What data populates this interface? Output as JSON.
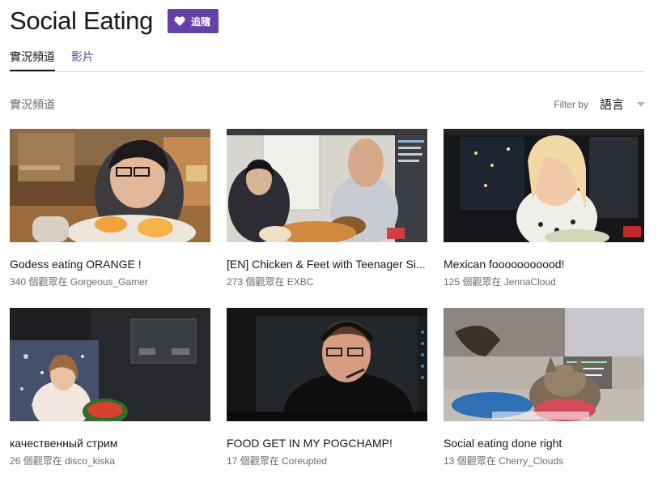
{
  "header": {
    "title": "Social Eating",
    "follow_label": "追隨"
  },
  "tabs": [
    {
      "label": "實況頻道",
      "active": true
    },
    {
      "label": "影片",
      "active": false
    }
  ],
  "section": {
    "label": "實況頻道",
    "filter_label": "Filter by",
    "filter_value": "語言"
  },
  "colors": {
    "accent": "#6441a4",
    "text": "#19171c",
    "muted": "#6b6b72",
    "divider": "#dad8de"
  },
  "streams": [
    {
      "title": "Godess eating ORANGE !",
      "viewers": "340",
      "viewers_suffix": "個觀眾在",
      "channel": "Gorgeous_Gamer"
    },
    {
      "title": "[EN] Chicken & Feet with Teenager Si...",
      "viewers": "273",
      "viewers_suffix": "個觀眾在",
      "channel": "EXBC"
    },
    {
      "title": "Mexican fooooooooood!",
      "viewers": "125",
      "viewers_suffix": "個觀眾在",
      "channel": "JennaCloud"
    },
    {
      "title": "качественный стрим",
      "viewers": "26",
      "viewers_suffix": "個觀眾在",
      "channel": "disco_kiska"
    },
    {
      "title": "FOOD GET IN MY POGCHAMP!",
      "viewers": "17",
      "viewers_suffix": "個觀眾在",
      "channel": "Coreupted"
    },
    {
      "title": "Social eating done right",
      "viewers": "13",
      "viewers_suffix": "個觀眾在",
      "channel": "Cherry_Clouds"
    }
  ]
}
